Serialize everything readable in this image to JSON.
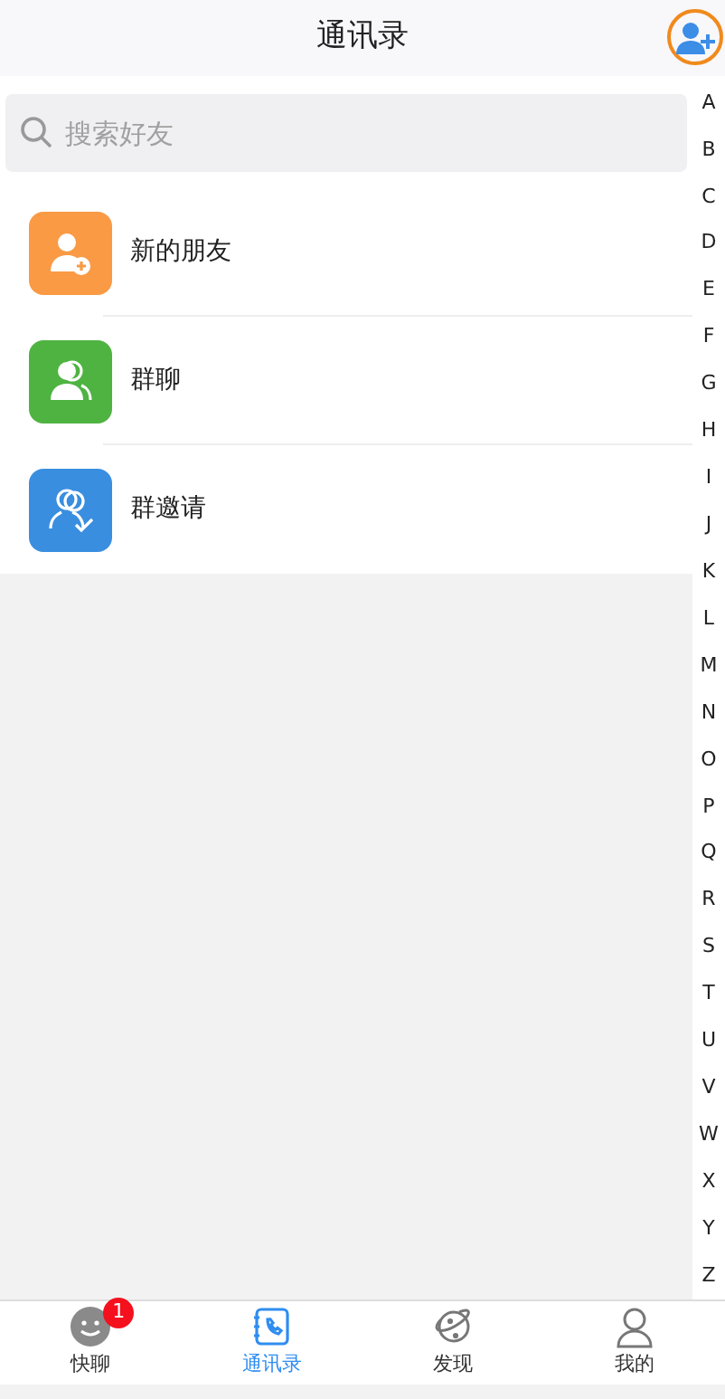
{
  "header": {
    "title": "通讯录"
  },
  "search": {
    "placeholder": "搜索好友"
  },
  "entries": [
    {
      "label": "新的朋友",
      "kind": "new-friend",
      "color": "#fa9a45"
    },
    {
      "label": "群聊",
      "kind": "group",
      "color": "#4fb342"
    },
    {
      "label": "群邀请",
      "kind": "invite",
      "color": "#3a8ee0"
    }
  ],
  "index": [
    "A",
    "B",
    "C",
    "D",
    "E",
    "F",
    "G",
    "H",
    "I",
    "J",
    "K",
    "L",
    "M",
    "N",
    "O",
    "P",
    "Q",
    "R",
    "S",
    "T",
    "U",
    "V",
    "W",
    "X",
    "Y",
    "Z"
  ],
  "tabs": [
    {
      "label": "快聊",
      "kind": "chat",
      "selected": false,
      "badge": "1"
    },
    {
      "label": "通讯录",
      "kind": "contacts",
      "selected": true
    },
    {
      "label": "发现",
      "kind": "discover",
      "selected": false
    },
    {
      "label": "我的",
      "kind": "me",
      "selected": false
    }
  ]
}
